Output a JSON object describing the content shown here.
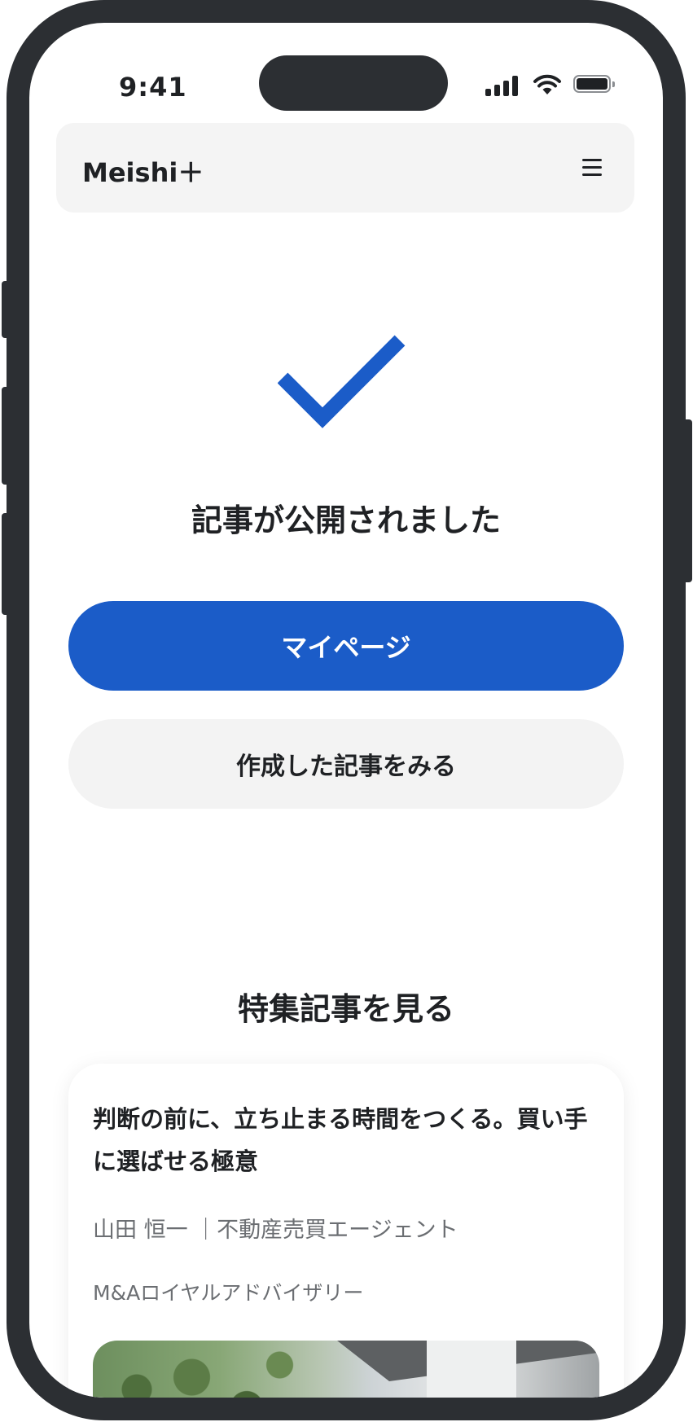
{
  "status_bar": {
    "time": "9:41"
  },
  "header": {
    "logo": "Meishi＋",
    "menu_icon": "hamburger-menu-icon"
  },
  "success": {
    "icon": "checkmark-icon",
    "title": "記事が公開されました",
    "primary_button": "マイページ",
    "secondary_button": "作成した記事をみる"
  },
  "featured": {
    "section_title": "特集記事を見る",
    "article": {
      "title": "判断の前に、立ち止まる時間をつくる。買い手に選ばせる極意",
      "author": "山田 恒一 ｜不動産売買エージェント",
      "company": "M&Aロイヤルアドバイザリー",
      "image": "building-interior-photo"
    }
  },
  "colors": {
    "accent": "#1b5cc8",
    "frame": "#2c2f33",
    "text": "#1f2124",
    "muted": "#6b6e72",
    "surface": "#f4f4f4"
  }
}
